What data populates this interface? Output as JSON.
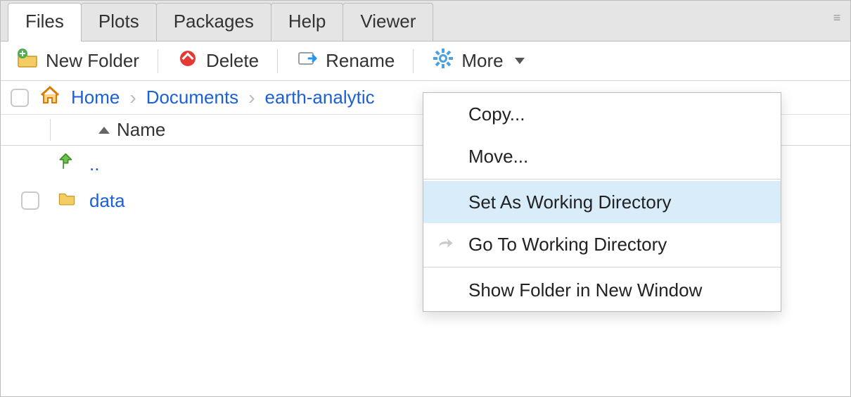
{
  "tabs": {
    "files": "Files",
    "plots": "Plots",
    "packages": "Packages",
    "help": "Help",
    "viewer": "Viewer"
  },
  "toolbar": {
    "new_folder": "New Folder",
    "delete": "Delete",
    "rename": "Rename",
    "more": "More"
  },
  "breadcrumb": {
    "home": "Home",
    "documents": "Documents",
    "earth_analytics": "earth-analytic"
  },
  "table": {
    "header_name": "Name",
    "parent": "..",
    "row1": "data"
  },
  "menu": {
    "copy": "Copy...",
    "move": "Move...",
    "set_wd": "Set As Working Directory",
    "goto_wd": "Go To Working Directory",
    "show_window": "Show Folder in New Window"
  }
}
